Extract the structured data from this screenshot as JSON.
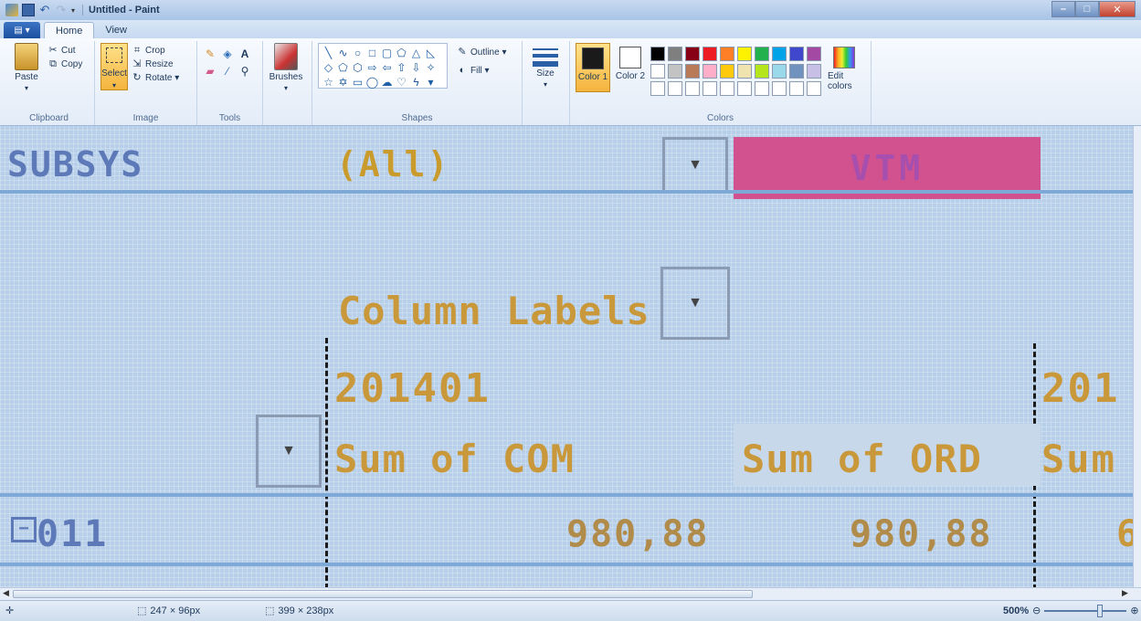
{
  "window": {
    "title": "Untitled - Paint"
  },
  "tabs": {
    "file": "▤ ▾",
    "home": "Home",
    "view": "View"
  },
  "ribbon": {
    "clipboard": {
      "label": "Clipboard",
      "paste": "Paste",
      "cut": "Cut",
      "copy": "Copy"
    },
    "image": {
      "label": "Image",
      "select": "Select",
      "crop": "Crop",
      "resize": "Resize",
      "rotate": "Rotate ▾"
    },
    "tools": {
      "label": "Tools"
    },
    "brushes": {
      "label": "Brushes"
    },
    "shapes": {
      "label": "Shapes",
      "outline": "Outline ▾",
      "fill": "Fill ▾"
    },
    "size": {
      "label": "Size"
    },
    "colors": {
      "label": "Colors",
      "color1": "Color 1",
      "color2": "Color 2",
      "edit": "Edit colors",
      "color1_value": "#1a1a1a",
      "color2_value": "#ffffff",
      "palette": [
        "#000000",
        "#7f7f7f",
        "#880015",
        "#ed1c24",
        "#ff7f27",
        "#fff200",
        "#22b14c",
        "#00a2e8",
        "#3f48cc",
        "#a349a4",
        "#ffffff",
        "#c3c3c3",
        "#b97a57",
        "#ffaec9",
        "#ffc90e",
        "#efe4b0",
        "#b5e61d",
        "#99d9ea",
        "#7092be",
        "#c8bfe7",
        "#ffffff",
        "#ffffff",
        "#ffffff",
        "#ffffff",
        "#ffffff",
        "#ffffff",
        "#ffffff",
        "#ffffff",
        "#ffffff",
        "#ffffff"
      ]
    }
  },
  "canvas": {
    "subsys": "SUBSYS",
    "all": "(All)",
    "vtm": "VTM",
    "column_labels": "Column Labels",
    "period1": "201401",
    "period2": "201",
    "sum_com": "Sum of COM",
    "sum_ord": "Sum of ORD",
    "sum_partial": "Sum",
    "row_label": "011",
    "collapse": "−",
    "value1": "980,88",
    "value2": "980,88",
    "value3": "6"
  },
  "statusbar": {
    "selection_size": "247 × 96px",
    "image_size": "399 × 238px",
    "zoom": "500%"
  }
}
